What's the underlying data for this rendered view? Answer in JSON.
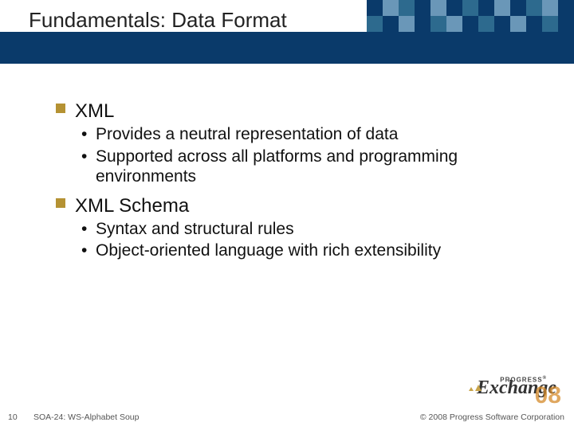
{
  "title": "Fundamentals: Data Format",
  "bullets": [
    {
      "label": "XML",
      "sub": [
        "Provides a neutral representation of data",
        "Supported across all platforms and programming environments"
      ]
    },
    {
      "label": "XML Schema",
      "sub": [
        "Syntax and structural rules",
        "Object-oriented language with rich extensibility"
      ]
    }
  ],
  "footer": {
    "slide_number": "10",
    "session": "SOA-24: WS-Alphabet Soup",
    "copyright": "© 2008 Progress Software Corporation"
  },
  "logo": {
    "top": "PROGRESS",
    "main": "Exchange",
    "year": "08"
  },
  "grid_colors": {
    "dark": "#0a3a6a",
    "teal": "#2d6a8e",
    "light": "#6a97b8"
  }
}
